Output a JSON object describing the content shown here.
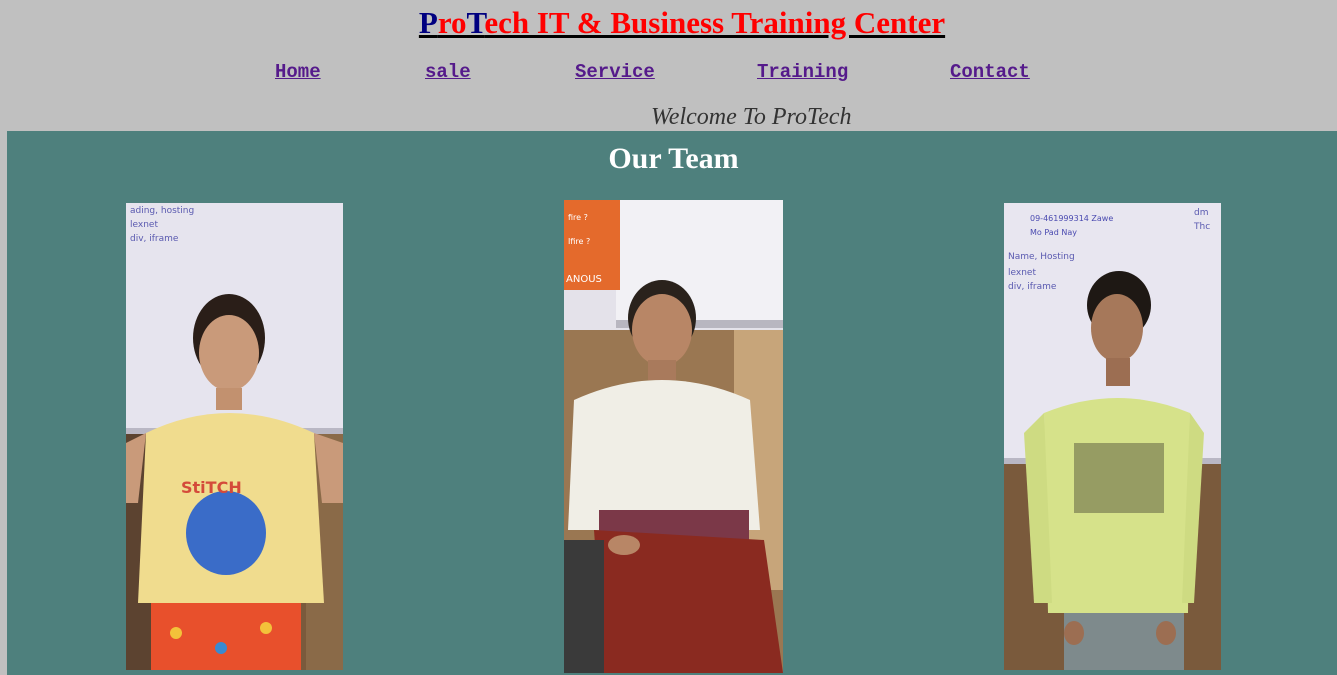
{
  "header": {
    "title_parts": [
      {
        "text": "P",
        "color": "#000080"
      },
      {
        "text": "ro",
        "color": "#ff0000"
      },
      {
        "text": "T",
        "color": "#000080"
      },
      {
        "text": "ech IT & Business Training Center",
        "color": "#ff0000"
      }
    ],
    "title_p": "P",
    "title_ro": "ro",
    "title_t": "T",
    "title_rest": "ech IT & Business Training Center"
  },
  "nav": {
    "home": "Home",
    "sale": "sale",
    "service": "Service",
    "training": "Training",
    "contact": "Contact"
  },
  "welcome": "Welcome To ProTech",
  "team": {
    "heading": "Our Team",
    "members": [
      {
        "photo_alt": "team-member-1-photo"
      },
      {
        "photo_alt": "team-member-2-photo"
      },
      {
        "photo_alt": "team-member-3-photo"
      }
    ]
  },
  "colors": {
    "page_bg": "#c0c0c0",
    "section_bg": "#4e807d",
    "link": "#551a8b",
    "title_red": "#ff0000",
    "title_navy": "#000080"
  }
}
